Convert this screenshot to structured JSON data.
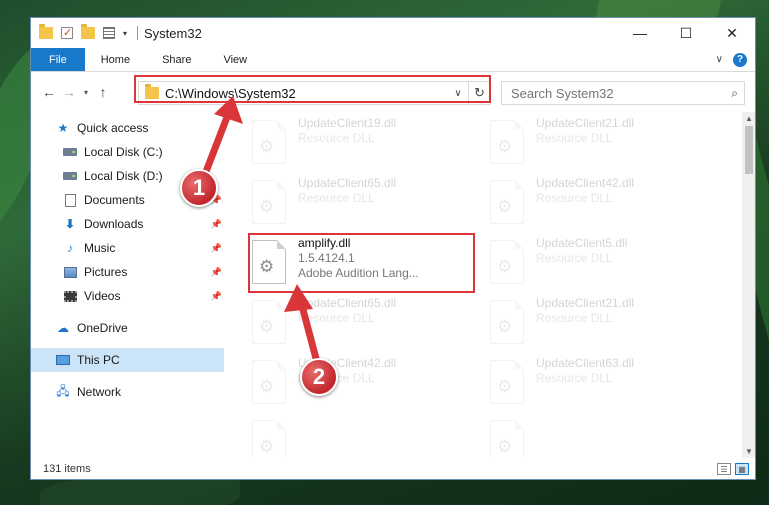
{
  "window": {
    "title": "System32",
    "minimize_glyph": "—",
    "maximize_glyph": "☐",
    "close_glyph": "✕"
  },
  "qat": {
    "dropdown_glyph": "▾",
    "title_separator": "|"
  },
  "ribbon": {
    "tabs": [
      "File",
      "Home",
      "Share",
      "View"
    ],
    "collapse_glyph": "∨",
    "help_glyph": "?"
  },
  "navigation": {
    "back_glyph": "←",
    "forward_glyph": "→",
    "recent_glyph": "▾",
    "up_glyph": "↑",
    "address": "C:\\Windows\\System32",
    "address_dropdown_glyph": "∨",
    "refresh_glyph": "↻",
    "search_placeholder": "Search System32",
    "search_glyph": "⌕"
  },
  "sidebar": {
    "items": [
      {
        "label": "Quick access",
        "icon": "star-icon"
      },
      {
        "label": "Local Disk (C:)",
        "icon": "disk-icon"
      },
      {
        "label": "Local Disk (D:)",
        "icon": "disk-icon"
      },
      {
        "label": "Documents",
        "icon": "documents-icon",
        "pinned": true
      },
      {
        "label": "Downloads",
        "icon": "downloads-icon",
        "pinned": true
      },
      {
        "label": "Music",
        "icon": "music-icon",
        "pinned": true
      },
      {
        "label": "Pictures",
        "icon": "pictures-icon",
        "pinned": true
      },
      {
        "label": "Videos",
        "icon": "videos-icon",
        "pinned": true
      },
      {
        "label": "OneDrive",
        "icon": "cloud-icon"
      },
      {
        "label": "This PC",
        "icon": "computer-icon",
        "selected": true
      },
      {
        "label": "Network",
        "icon": "network-icon"
      }
    ],
    "pin_glyph": "📌"
  },
  "files": {
    "left_column": [
      {
        "name": "UpdateClient19.dll",
        "line2": "Resource DLL"
      },
      {
        "name": "UpdateClient65.dll",
        "line2": "Resource DLL"
      },
      {
        "name": "amplify.dll",
        "line2": "1.5.4124.1",
        "line3": "Adobe Audition Lang...",
        "highlighted": true
      },
      {
        "name": "UpdateClient65.dll",
        "line2": "Resource DLL"
      },
      {
        "name": "UpdateClient42.dll",
        "line2": "Resource DLL"
      },
      {
        "name": "",
        "line2": ""
      }
    ],
    "right_column": [
      {
        "name": "UpdateClient21.dll",
        "line2": "Resource DLL"
      },
      {
        "name": "UpdateClient42.dll",
        "line2": "Resource DLL"
      },
      {
        "name": "UpdateClient5.dll",
        "line2": "Resource DLL"
      },
      {
        "name": "UpdateClient21.dll",
        "line2": "Resource DLL"
      },
      {
        "name": "UpdateClient63.dll",
        "line2": "Resource DLL"
      },
      {
        "name": "",
        "line2": ""
      }
    ],
    "gear_glyph": "⚙"
  },
  "scrollbar": {
    "up_glyph": "▲",
    "down_glyph": "▼"
  },
  "status": {
    "item_count": "131 items",
    "details_view_glyph": "☰",
    "tiles_view_glyph": "▦"
  },
  "annotations": {
    "step1": "1",
    "step2": "2",
    "highlight_color": "#d9363a"
  },
  "colors": {
    "accent": "#1979ca",
    "selection": "#cce4f7"
  }
}
